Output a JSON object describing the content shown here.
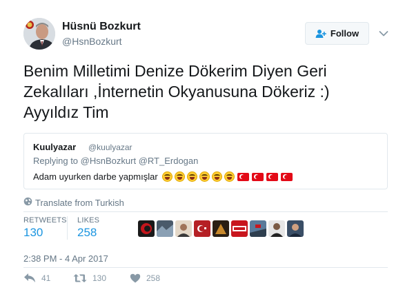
{
  "author": {
    "name": "Hüsnü Bozkurt",
    "handle": "@HsnBozkurt"
  },
  "follow_button": {
    "label": "Follow",
    "icon": "add-user-icon"
  },
  "tweet": {
    "text": "Benim Milletimi Denize Dökerim Diyen Geri\nZekalıları ,İnternetin Okyanusuna Dökeriz :)\nAyyıldız Tim"
  },
  "quoted_tweet": {
    "name": "Kuulyazar",
    "handle": "@kuulyazar",
    "replying_to_prefix": "Replying to",
    "replying_to": [
      "@HsnBozkurt",
      "@RT_Erdogan"
    ],
    "text": "Adam uyurken darbe yapmışlar",
    "emojis": [
      "face-with-tears-of-joy",
      "face-with-tears-of-joy",
      "face-with-tears-of-joy",
      "face-with-tears-of-joy",
      "face-with-tears-of-joy",
      "face-with-tears-of-joy",
      "flag-turkey",
      "flag-turkey",
      "flag-turkey",
      "flag-turkey"
    ]
  },
  "translate": {
    "label": "Translate from Turkish",
    "icon": "globe-icon"
  },
  "stats": {
    "retweets_label": "RETWEETS",
    "retweets_value": "130",
    "likes_label": "LIKES",
    "likes_value": "258"
  },
  "timestamp": "2:38 PM - 4 Apr 2017",
  "actions": {
    "reply_count": "41",
    "retweet_count": "130",
    "like_count": "258"
  },
  "colors": {
    "link_blue": "#1b95e0",
    "muted_gray": "#657786",
    "border": "#e1e8ed"
  }
}
